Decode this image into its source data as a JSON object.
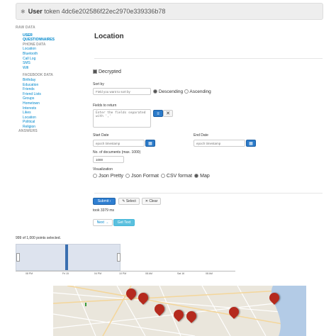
{
  "header": {
    "title": "User",
    "token_text": "token 4dc6e202586f22ec2970e339336b78"
  },
  "sidebar": {
    "raw_data": "RAW DATA",
    "user": "USER",
    "questionnaires": "QUESTIONNAIRES",
    "phone_data": "PHONE DATA",
    "phone_items": [
      "Location",
      "Bluetooth",
      "Call Log",
      "SMS",
      "Wifi"
    ],
    "facebook_data": "FACEBOOK DATA",
    "facebook_items": [
      "Birthday",
      "Education",
      "Friends",
      "Friend Lists",
      "Groups",
      "Hometown",
      "Interests",
      "Likes",
      "Location",
      "Political",
      "Religion"
    ],
    "answers": "ANSWERS"
  },
  "main": {
    "title": "Location",
    "decrypted_label": "Decrypted",
    "sort_by_label": "Sort by",
    "sort_placeholder": "Field you want to sort by",
    "descending_label": "Descending",
    "ascending_label": "Ascending",
    "fields_label": "Fields to return",
    "fields_placeholder": "Enter the fields separated with ','",
    "start_date_label": "Start Date",
    "start_placeholder": "epoch timestamp",
    "end_date_label": "End Date",
    "end_placeholder": "epoch timestamp",
    "num_docs_label": "No. of documents (max. 1000)",
    "num_docs_value": "1000",
    "visualization_label": "Visualization",
    "viz_options": [
      "Json Pretty",
      "Json Format",
      "CSV format",
      "Map"
    ],
    "submit_label": "Submit",
    "select_label": "Select",
    "clear_label": "Clear",
    "took_text": "took 3379 ms",
    "next_label": "Next →",
    "get_text_label": "Get Text"
  },
  "timeline": {
    "selected_text": "999 of 1,000 points selected.",
    "ticks": [
      "08 PM",
      "Fri 15",
      "04 PM",
      "10 PM",
      "08 AM",
      "Sat 16",
      "08 AM"
    ]
  },
  "icons": {
    "submit": "chevron-right-icon",
    "select": "pencil-icon",
    "clear": "close-icon",
    "start_cal": "calendar-icon",
    "end_cal": "calendar-icon",
    "map_marker": "map-marker-icon"
  },
  "colors": {
    "primary": "#2e7ed1",
    "info": "#5bc0de",
    "marker": "#b52a1e",
    "link": "#0088cc"
  }
}
